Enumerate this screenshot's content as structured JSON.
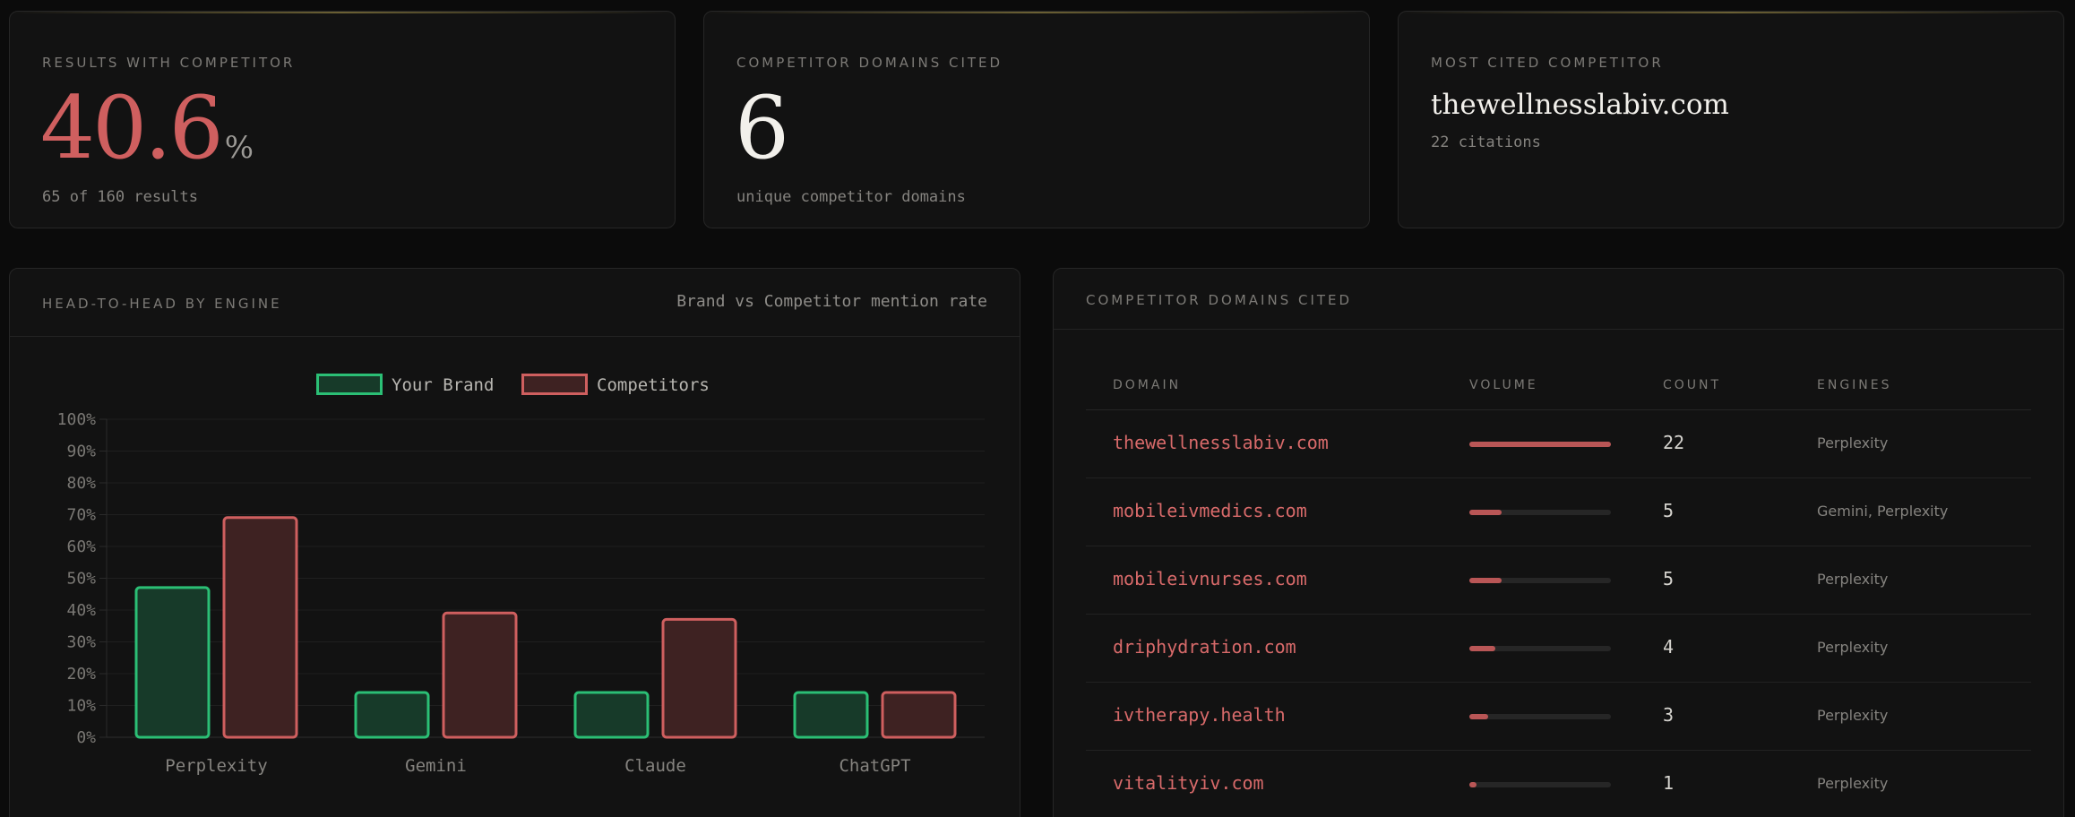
{
  "stats": {
    "results_with_competitor": {
      "label": "RESULTS WITH COMPETITOR",
      "value": "40.6",
      "unit": "%",
      "sub": "65 of 160 results"
    },
    "competitor_domains_cited": {
      "label": "COMPETITOR DOMAINS CITED",
      "value": "6",
      "sub": "unique competitor domains"
    },
    "most_cited_competitor": {
      "label": "MOST CITED COMPETITOR",
      "domain": "thewellnesslabiv.com",
      "sub": "22 citations"
    }
  },
  "head_to_head": {
    "title": "HEAD-TO-HEAD BY ENGINE",
    "subtitle": "Brand vs Competitor mention rate"
  },
  "chart_data": {
    "type": "bar",
    "categories": [
      "Perplexity",
      "Gemini",
      "Claude",
      "ChatGPT"
    ],
    "series": [
      {
        "name": "Your Brand",
        "values": [
          47.5,
          14.5,
          14.5,
          14.5
        ]
      },
      {
        "name": "Competitors",
        "values": [
          69.5,
          39.5,
          37.5,
          14.5
        ]
      }
    ],
    "ylim": [
      0,
      100
    ],
    "yticks": [
      "0%",
      "10%",
      "20%",
      "30%",
      "40%",
      "50%",
      "60%",
      "70%",
      "80%",
      "90%",
      "100%"
    ],
    "legend": "top-center",
    "grid": true,
    "colors": {
      "brand_stroke": "#2bbf75",
      "brand_fill": "#173a29",
      "comp_stroke": "#cf5f5f",
      "comp_fill": "#3e2222"
    }
  },
  "domains_table": {
    "title": "COMPETITOR DOMAINS CITED",
    "headers": {
      "domain": "DOMAIN",
      "volume": "VOLUME",
      "count": "COUNT",
      "engines": "ENGINES"
    },
    "rows": [
      {
        "domain": "thewellnesslabiv.com",
        "volume": 1.0,
        "count": "22",
        "engines": "Perplexity"
      },
      {
        "domain": "mobileivmedics.com",
        "volume": 0.227,
        "count": "5",
        "engines": "Gemini, Perplexity"
      },
      {
        "domain": "mobileivnurses.com",
        "volume": 0.227,
        "count": "5",
        "engines": "Perplexity"
      },
      {
        "domain": "driphydration.com",
        "volume": 0.182,
        "count": "4",
        "engines": "Perplexity"
      },
      {
        "domain": "ivtherapy.health",
        "volume": 0.136,
        "count": "3",
        "engines": "Perplexity"
      },
      {
        "domain": "vitalityiv.com",
        "volume": 0.045,
        "count": "1",
        "engines": "Perplexity"
      }
    ]
  }
}
